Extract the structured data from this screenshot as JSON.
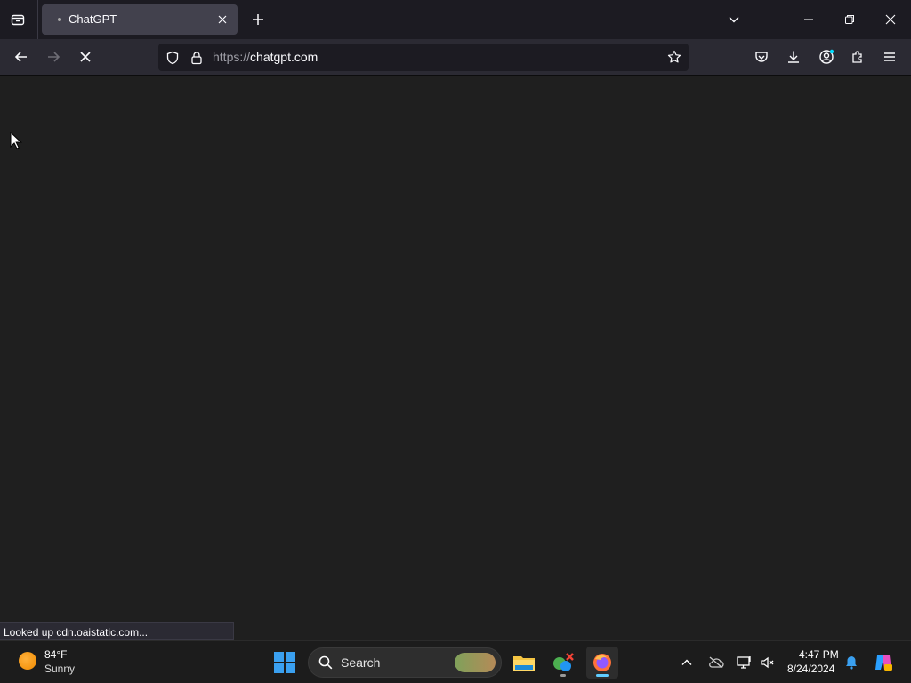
{
  "browser": {
    "tab": {
      "title": "ChatGPT"
    },
    "url": {
      "scheme": "https://",
      "host": "chatgpt.com"
    },
    "status_text": "Looked up cdn.oaistatic.com..."
  },
  "taskbar": {
    "weather": {
      "temp": "84°F",
      "condition": "Sunny"
    },
    "search_label": "Search",
    "clock": {
      "time": "4:47 PM",
      "date": "8/24/2024"
    }
  },
  "colors": {
    "tab_active": "#42414d",
    "toolbar": "#2b2a33",
    "content_bg": "#1f1f1f",
    "accent": "#60cdff"
  }
}
